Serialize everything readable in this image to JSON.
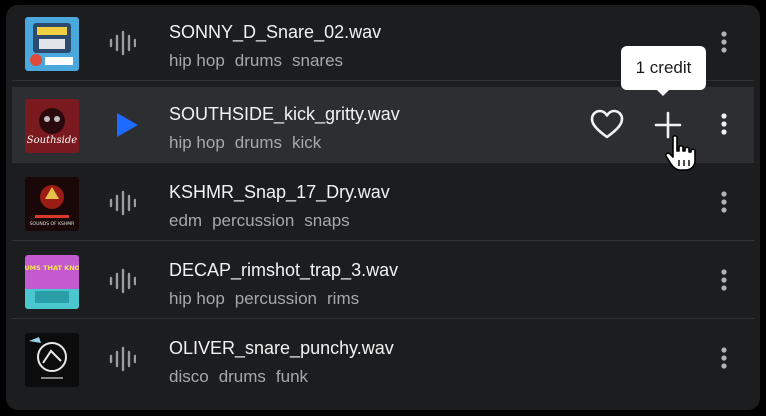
{
  "colors": {
    "panel_bg": "#1c1d1f",
    "active_row_bg": "#2c2e32",
    "accent_play": "#1e6bff",
    "title_text": "#f2f2f2",
    "tag_text": "#a6a8ad"
  },
  "tooltip": {
    "text": "1 credit"
  },
  "samples": [
    {
      "filename": "SONNY_D_Snare_02.wav",
      "tags": [
        "hip hop",
        "drums",
        "snares"
      ],
      "status_icon": "waveform-icon"
    },
    {
      "filename": "SOUTHSIDE_kick_gritty.wav",
      "tags": [
        "hip hop",
        "drums",
        "kick"
      ],
      "status_icon": "play-icon",
      "cover_text": "Southside"
    },
    {
      "filename": "KSHMR_Snap_17_Dry.wav",
      "tags": [
        "edm",
        "percussion",
        "snaps"
      ],
      "status_icon": "waveform-icon",
      "cover_text": "SOUNDS OF KSHMR"
    },
    {
      "filename": "DECAP_rimshot_trap_3.wav",
      "tags": [
        "hip hop",
        "percussion",
        "rims"
      ],
      "status_icon": "waveform-icon",
      "cover_text": "DRUMS THAT KNOCK"
    },
    {
      "filename": "OLIVER_snare_punchy.wav",
      "tags": [
        "disco",
        "drums",
        "funk"
      ],
      "status_icon": "waveform-icon"
    }
  ]
}
